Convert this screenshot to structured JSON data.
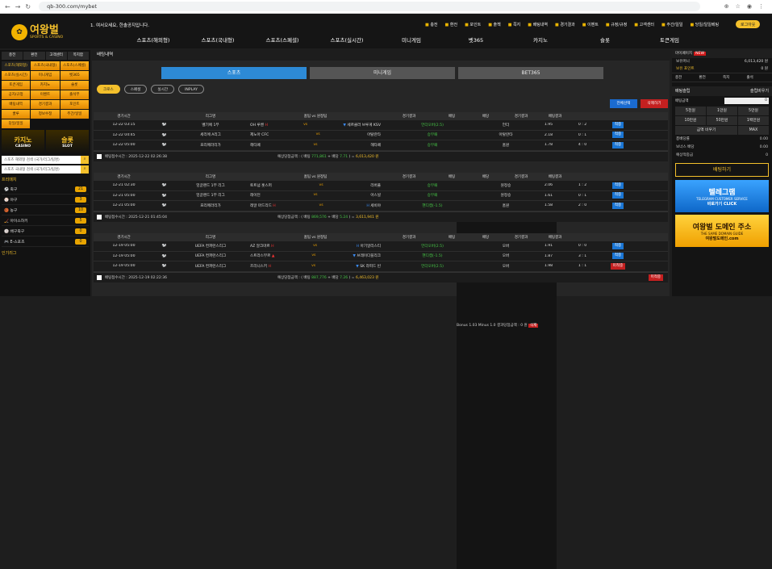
{
  "browser": {
    "url": "qb-300.com/mybet",
    "back": "←",
    "forward": "→",
    "reload": "↻"
  },
  "top": {
    "logo_text": "여왕벌",
    "logo_sub": "SPORTS & CASINO",
    "notice": "1. 여서오세요, 한솔공지입니다.",
    "links": [
      "충전",
      "환전",
      "포인트",
      "출첵",
      "쪽지",
      "배팅내역",
      "경기결과",
      "이벤트",
      "규정/규정",
      "고객센터",
      "주간/일일",
      "당일/일일베팅"
    ],
    "logout": "로그아웃"
  },
  "mainnav": [
    "스포츠(해외형)",
    "스포츠(국내형)",
    "스포츠(스페셜)",
    "스포츠(실시간)",
    "미니게임",
    "벳365",
    "카지노",
    "슬롯",
    "토큰게임"
  ],
  "sidebar": {
    "quick": [
      "충전",
      "환전",
      "고객센터",
      "쪽지함"
    ],
    "grid": [
      "스포츠(해외형)",
      "스포츠(국내형)",
      "스포츠(스페셜)",
      "스포츠(실시간)",
      "미니게임",
      "벳365",
      "토큰게임",
      "카지노",
      "슬롯",
      "공지/규정",
      "이벤트",
      "출석부",
      "배팅내역",
      "경기결과",
      "포인트",
      "쿨루",
      "정보수정",
      "주간/일일",
      "당일/일일"
    ],
    "banners": [
      {
        "title": "카지노",
        "sub": "CASINO"
      },
      {
        "title": "슬롯",
        "sub": "SLOT"
      }
    ],
    "search1": "스포츠 해외형 검색 (국가/리그/팀명)",
    "search2": "스포츠 국내형 검색 (국가/리그/팀명)",
    "sport_header": "프리매치",
    "sports": [
      {
        "name": "축구",
        "count": "21"
      },
      {
        "name": "야구",
        "count": "3"
      },
      {
        "name": "농구",
        "count": "10"
      },
      {
        "name": "아이스하키",
        "count": "5"
      },
      {
        "name": "배구축구",
        "count": "0"
      },
      {
        "name": "E-스포츠",
        "count": "0"
      }
    ],
    "footer": "인기리그"
  },
  "main": {
    "title": "배팅내역",
    "tabs": [
      "스포츠",
      "미니게임",
      "BET365"
    ],
    "pills": [
      "크로스",
      "스페셜",
      "실시간",
      "INPLAY"
    ],
    "btn_all": "전체선택",
    "btn_del": "삭제하기",
    "headers": [
      "경기시간",
      "",
      "리그명",
      "홈팀 vs 원정팀",
      "",
      "경기결과",
      "배팅",
      "배당",
      "경기결과",
      "배팅결과"
    ],
    "blocks": [
      {
        "rows": [
          {
            "time": "12-22 03:15",
            "league": "벨기에 1부",
            "home": "OH 루벤",
            "home_mark": "H",
            "away": "세르클러 브루게 KSV",
            "away_mark": "▼",
            "market": "언더오버(2.5)",
            "pick": "언더",
            "odds": "1.95",
            "score": "0 : 2",
            "result": "적중"
          },
          {
            "time": "12-22 04:45",
            "league": "세리에 A리그",
            "home": "제노아 CFC",
            "home_mark": "",
            "away": "아탈란타",
            "away_mark": "",
            "market": "승무패",
            "pick": "아탈란타",
            "odds": "2.18",
            "score": "0 : 1",
            "result": "적중"
          },
          {
            "time": "12-22 05:00",
            "league": "프리메라리가",
            "home": "헤타페",
            "home_mark": "",
            "away": "헤타페",
            "away_mark": "",
            "market": "승무패",
            "pick": "홈원",
            "odds": "1.78",
            "score": "4 : 0",
            "result": "적중"
          }
        ],
        "footer": {
          "date": "배팅접수시간 : 2025-12-22 02:26:38",
          "bet_text": "예상당첨금액 : ( 배팅",
          "bet_amount": "771,861",
          "odds_label": "+ 배당",
          "odds": "7.71",
          "win_amount": "6,013,420 원",
          "bonus": "Bonus 1.05  Minus 1.0",
          "final": "결과당첨금액 : 6,013,420 원",
          "status": "삭제"
        }
      },
      {
        "rows": [
          {
            "time": "12-21 02:30",
            "league": "잉글랜드 1부 리그",
            "home": "토트넘 홋스퍼",
            "home_mark": "",
            "away": "리버풀",
            "away_mark": "",
            "market": "승무패",
            "pick": "원정승",
            "odds": "2.06",
            "score": "1 : 2",
            "result": "적중"
          },
          {
            "time": "12-21 05:00",
            "league": "잉글랜드 1부 리그",
            "home": "레이턴",
            "home_mark": "",
            "away": "아스널",
            "away_mark": "",
            "market": "승무패",
            "pick": "원정승",
            "odds": "1.61",
            "score": "0 : 1",
            "result": "적중"
          },
          {
            "time": "12-21 05:00",
            "league": "프리메라리가",
            "home": "레알 마드리드",
            "home_mark": "H",
            "away": "세비야",
            "away_mark": "H",
            "market": "핸디캡(-1.5)",
            "pick": "홈원",
            "odds": "1.58",
            "score": "2 : 0",
            "result": "적중"
          }
        ],
        "footer": {
          "date": "배팅접수시간 : 2025-12-21 01:45:04",
          "bet_text": "예상당첨금액 : ( 배팅",
          "bet_amount": "869,576",
          "odds_label": "+ 배당",
          "odds": "5.24",
          "win_amount": "3,611,941 원",
          "bonus": "Bonus 1.07  Minus 1.0",
          "final": "결과당첨금액 : 3,611,941 원",
          "status": "삭제"
        }
      },
      {
        "rows": [
          {
            "time": "12-19 05:00",
            "league": "UEFA 컨퍼런스리그",
            "home": "AZ 알크마르",
            "home_mark": "H",
            "away": "아기알리스티",
            "away_mark": "H",
            "market": "언더오버(2.5)",
            "pick": "오버",
            "odds": "1.91",
            "score": "0 : 0",
            "result": "적중"
          },
          {
            "time": "12-19 05:00",
            "league": "UEFA 컨퍼런스리그",
            "home": "스트라스부르",
            "home_mark": "▲",
            "away": "브레이다블리크",
            "away_mark": "▼",
            "market": "핸디캡(-1.5)",
            "pick": "오버",
            "odds": "1.87",
            "score": "3 : 1",
            "result": "적중"
          },
          {
            "time": "12-19 05:00",
            "league": "UEFA 컨퍼런스리그",
            "home": "즈리니스키",
            "home_mark": "H",
            "away": "SK 라피드 빈",
            "away_mark": "▼",
            "market": "언더오버(2.5)",
            "pick": "오버",
            "odds": "1.98",
            "score": "1 : 1",
            "result": "미적중"
          }
        ],
        "footer": {
          "date": "배팅접수시간 : 2025-12-19 02:22:36",
          "bet_text": "예상당첨금액 : ( 배팅",
          "bet_amount": "887,776",
          "odds_label": "+ 배당",
          "odds": "7.26",
          "win_amount": "6,463,023 원",
          "bonus": "Bonus 1.03  Minus 1.0",
          "final": "결과당첨금액 : 0 원",
          "status": "삭제",
          "end": "미적중"
        }
      }
    ]
  },
  "right": {
    "my_info": "마이페이지",
    "new": "NEW",
    "balance_label": "보유머니",
    "balance": "6,013,420 원",
    "point_label": "보유 포인트",
    "point": "0 원",
    "quick": [
      "충전",
      "환전",
      "쪽지",
      "출석"
    ],
    "slip_title": "배팅슬립",
    "slip_clear": "슬립비우기",
    "bet_amount_label": "배팅금액",
    "bet_amount": "0",
    "amounts": [
      "5천원",
      "1만원",
      "5만원",
      "10만원",
      "50만원",
      "1백만원",
      "금액 비우기",
      "MAX"
    ],
    "sums": [
      {
        "label": "총배당률",
        "value": "0.00"
      },
      {
        "label": "보너스 배당",
        "value": "0.00"
      },
      {
        "label": "예상적중금",
        "value": "0"
      }
    ],
    "bet_button": "배팅하기",
    "ad1": {
      "title": "텔레그램",
      "sub": "TELEGRAM CUSTOMER SERVICE",
      "cta": "바로가기 CLICK"
    },
    "ad2": {
      "title": "여왕벌 도메인 주소",
      "sub": "THE SAME DOMAIN GUIDE",
      "cta": "여왕벌도메인.com"
    }
  }
}
